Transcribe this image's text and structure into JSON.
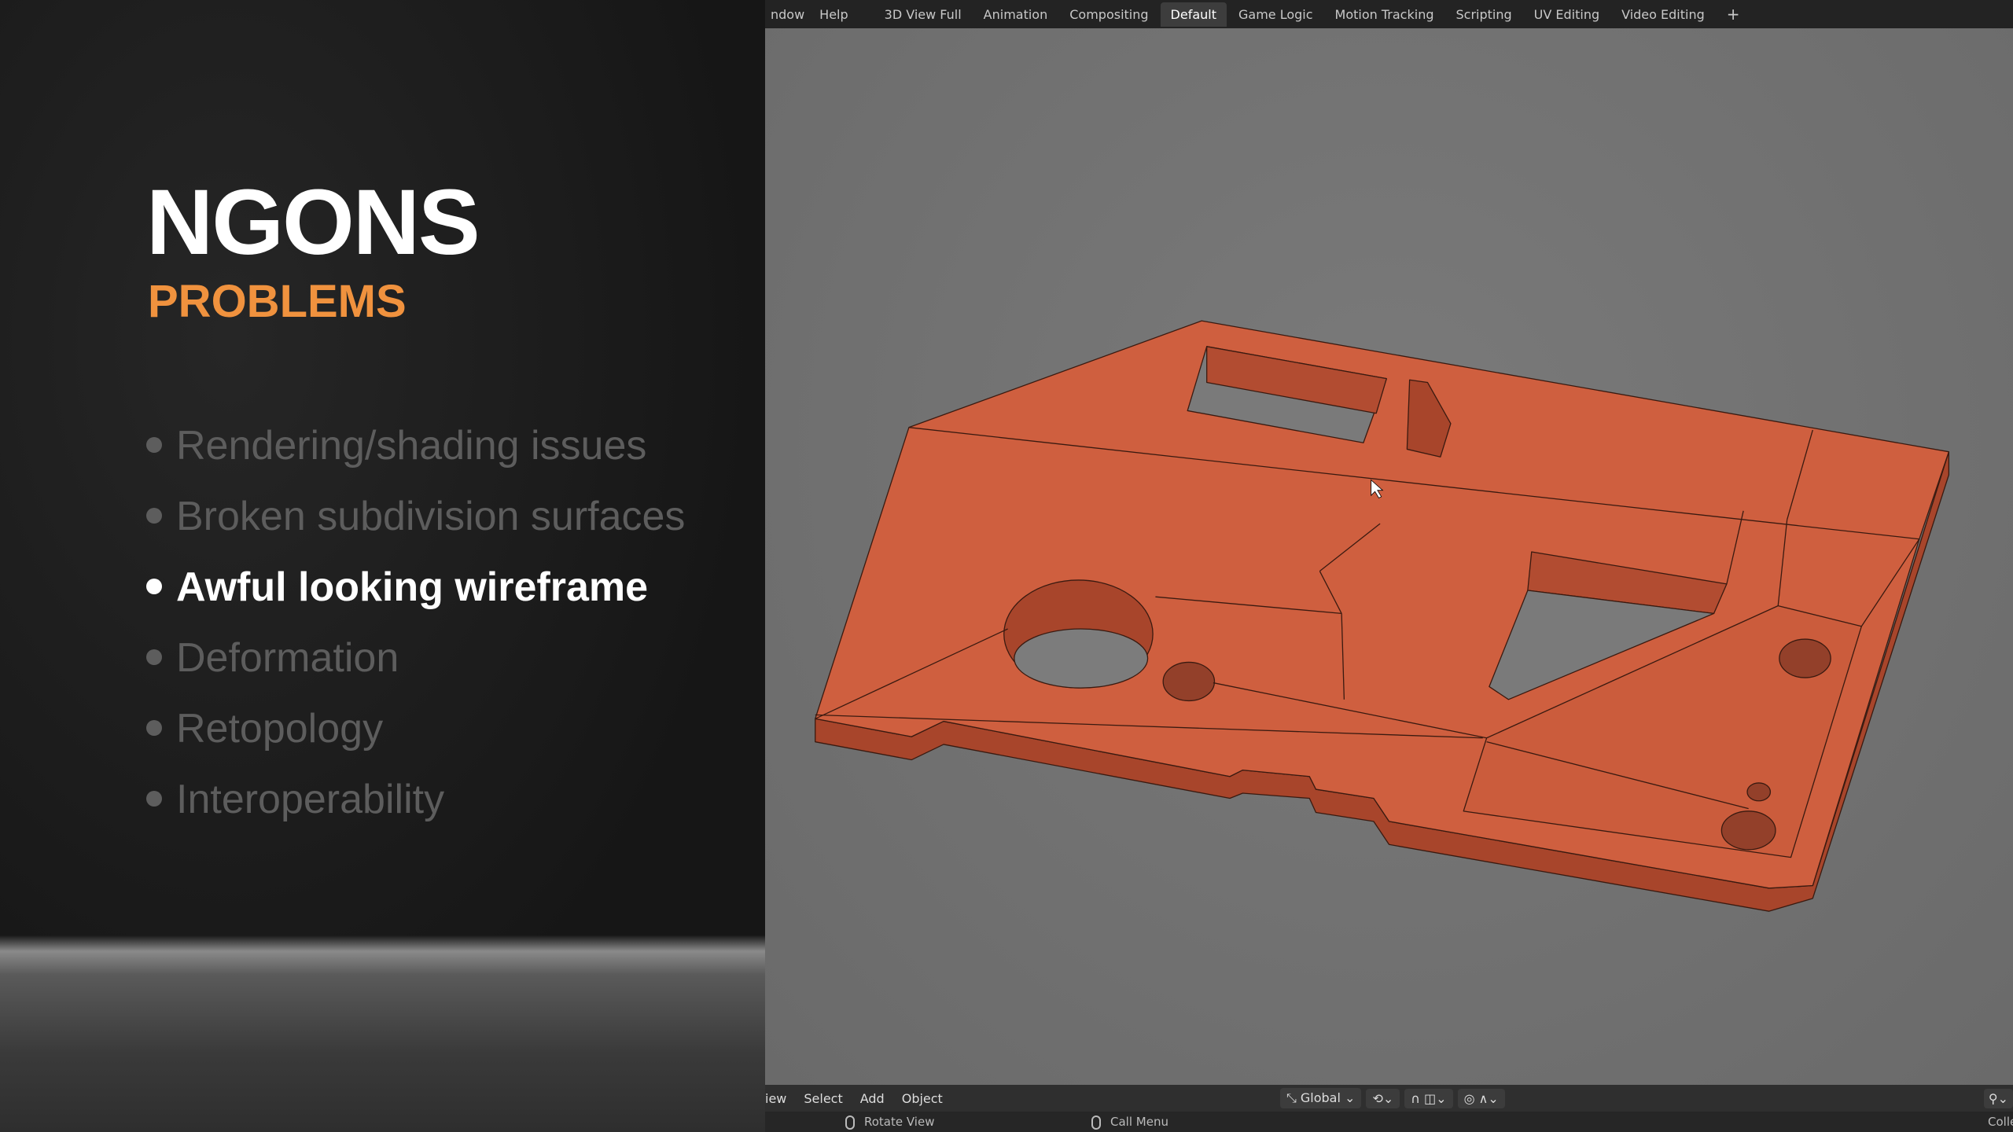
{
  "slide": {
    "title": "NGONS",
    "subtitle": "PROBLEMS",
    "accent": "#f0923e",
    "bullets": [
      {
        "label": "Rendering/shading issues",
        "active": false
      },
      {
        "label": "Broken subdivision surfaces",
        "active": false
      },
      {
        "label": "Awful looking wireframe",
        "active": true
      },
      {
        "label": "Deformation",
        "active": false
      },
      {
        "label": "Retopology",
        "active": false
      },
      {
        "label": "Interoperability",
        "active": false
      }
    ]
  },
  "topbar": {
    "menus": [
      "ndow",
      "Help"
    ],
    "tabs": [
      "3D View Full",
      "Animation",
      "Compositing",
      "Default",
      "Game Logic",
      "Motion Tracking",
      "Scripting",
      "UV Editing",
      "Video Editing"
    ],
    "active_tab": "Default",
    "add": "+"
  },
  "header": {
    "menus": [
      "iew",
      "Select",
      "Add",
      "Object"
    ],
    "orientation": "Global"
  },
  "status": {
    "left": "Rotate View",
    "middle": "Call Menu",
    "right": "Colle"
  },
  "model_color": "#d0603f"
}
